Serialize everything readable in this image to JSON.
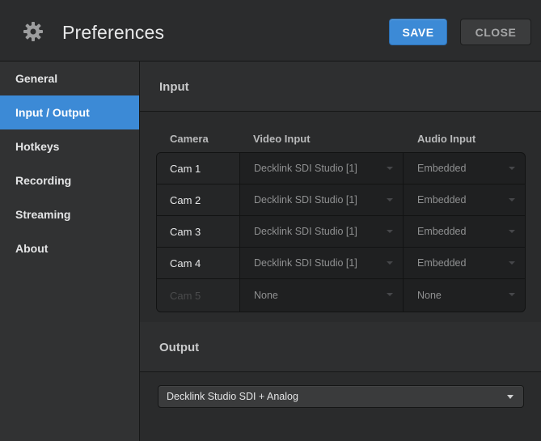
{
  "header": {
    "title": "Preferences",
    "icon": "gear-icon",
    "save_label": "SAVE",
    "close_label": "CLOSE"
  },
  "sidebar": {
    "items": [
      {
        "label": "General",
        "active": false
      },
      {
        "label": "Input / Output",
        "active": true
      },
      {
        "label": "Hotkeys",
        "active": false
      },
      {
        "label": "Recording",
        "active": false
      },
      {
        "label": "Streaming",
        "active": false
      },
      {
        "label": "About",
        "active": false
      }
    ]
  },
  "input": {
    "section_title": "Input",
    "columns": [
      "Camera",
      "Video Input",
      "Audio Input"
    ],
    "rows": [
      {
        "camera": "Cam 1",
        "video": "Decklink SDI Studio [1]",
        "audio": "Embedded",
        "enabled": true
      },
      {
        "camera": "Cam 2",
        "video": "Decklink SDI Studio [1]",
        "audio": "Embedded",
        "enabled": true
      },
      {
        "camera": "Cam 3",
        "video": "Decklink SDI Studio [1]",
        "audio": "Embedded",
        "enabled": true
      },
      {
        "camera": "Cam 4",
        "video": "Decklink SDI Studio [1]",
        "audio": "Embedded",
        "enabled": true
      },
      {
        "camera": "Cam 5",
        "video": "None",
        "audio": "None",
        "enabled": false
      }
    ]
  },
  "output": {
    "section_title": "Output",
    "selected": "Decklink Studio SDI + Analog"
  },
  "colors": {
    "accent": "#3c8ad6",
    "background": "#2a2b2c",
    "sidebar": "#313233"
  }
}
